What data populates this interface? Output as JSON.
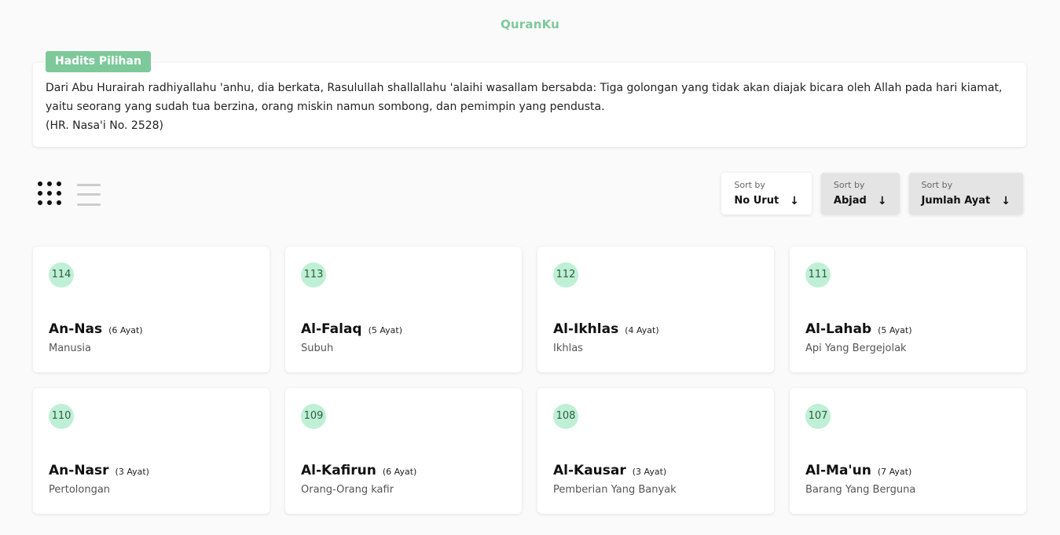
{
  "brand": "QuranKu",
  "hadits": {
    "badge": "Hadits Pilihan",
    "text": "Dari Abu Hurairah radhiyallahu 'anhu, dia berkata, Rasulullah shallallahu 'alaihi wasallam bersabda: Tiga golongan yang tidak akan diajak bicara oleh Allah pada hari kiamat, yaitu seorang yang sudah tua berzina, orang miskin namun sombong, dan pemimpin yang pendusta.",
    "source": "(HR. Nasa'i No. 2528)"
  },
  "view_toggle": {
    "active": "grid",
    "icons": [
      "grid-icon",
      "list-icon"
    ]
  },
  "sort": [
    {
      "label": "Sort by",
      "value": "No Urut",
      "icon": "arrow-down-icon",
      "active": true
    },
    {
      "label": "Sort by",
      "value": "Abjad",
      "icon": "arrow-down-icon",
      "active": false
    },
    {
      "label": "Sort by",
      "value": "Jumlah Ayat",
      "icon": "arrow-down-icon",
      "active": false
    }
  ],
  "surahs": [
    {
      "number": "114",
      "name": "An-Nas",
      "ayat": "(6 Ayat)",
      "meaning": "Manusia"
    },
    {
      "number": "113",
      "name": "Al-Falaq",
      "ayat": "(5 Ayat)",
      "meaning": "Subuh"
    },
    {
      "number": "112",
      "name": "Al-Ikhlas",
      "ayat": "(4 Ayat)",
      "meaning": "Ikhlas"
    },
    {
      "number": "111",
      "name": "Al-Lahab",
      "ayat": "(5 Ayat)",
      "meaning": "Api Yang Bergejolak"
    },
    {
      "number": "110",
      "name": "An-Nasr",
      "ayat": "(3 Ayat)",
      "meaning": "Pertolongan"
    },
    {
      "number": "109",
      "name": "Al-Kafirun",
      "ayat": "(6 Ayat)",
      "meaning": "Orang-Orang kafir"
    },
    {
      "number": "108",
      "name": "Al-Kausar",
      "ayat": "(3 Ayat)",
      "meaning": "Pemberian Yang Banyak"
    },
    {
      "number": "107",
      "name": "Al-Ma'un",
      "ayat": "(7 Ayat)",
      "meaning": "Barang Yang Berguna"
    }
  ],
  "colors": {
    "accent": "#7ec99a",
    "number_badge": "#bff0d6",
    "background": "#fafafa"
  }
}
